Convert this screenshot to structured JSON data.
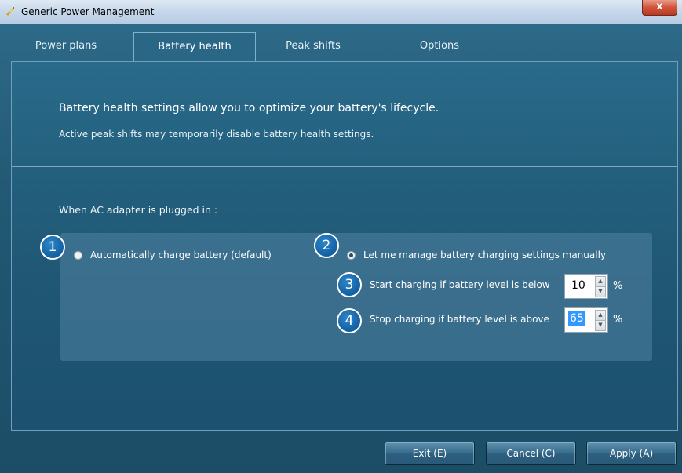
{
  "window": {
    "title": "Generic Power Management",
    "close_label": "x"
  },
  "tabs": [
    {
      "label": "Power plans"
    },
    {
      "label": "Battery health"
    },
    {
      "label": "Peak shifts"
    },
    {
      "label": "Options"
    }
  ],
  "description": {
    "line1": "Battery health settings allow you to optimize your battery's lifecycle.",
    "line2": "Active peak shifts may temporarily disable battery health settings."
  },
  "ac_section": {
    "heading": "When AC adapter is plugged in :",
    "option_auto": {
      "badge": "1",
      "label": "Automatically charge battery (default)",
      "selected": false
    },
    "option_manual": {
      "badge": "2",
      "label": "Let me manage battery charging settings manually",
      "selected": true
    },
    "start": {
      "badge": "3",
      "label": "Start charging if battery level is below",
      "value": "10",
      "unit": "%"
    },
    "stop": {
      "badge": "4",
      "label": "Stop charging if battery level is above",
      "value": "65",
      "unit": "%"
    }
  },
  "buttons": {
    "exit": "Exit (E)",
    "cancel": "Cancel (C)",
    "apply": "Apply (A)"
  },
  "colors": {
    "accent": "#1160a3",
    "background": "#215873",
    "titlebar": "#c7d8ea"
  },
  "icons": {
    "app": "power-plug-icon",
    "close": "close-icon"
  }
}
